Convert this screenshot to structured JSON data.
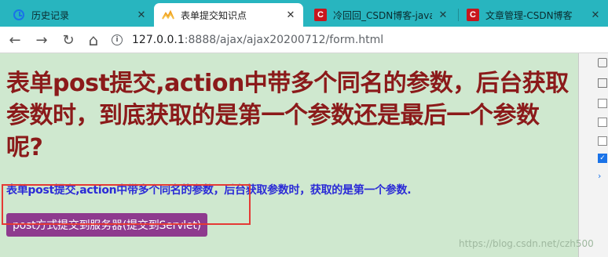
{
  "tabs": [
    {
      "label": "历史记录",
      "icon": "history-icon",
      "active": false
    },
    {
      "label": "表单提交知识点",
      "icon": "page-icon",
      "active": true
    },
    {
      "label": "冷回回_CSDN博客-java",
      "icon": "csdn-icon",
      "active": false
    },
    {
      "label": "文章管理-CSDN博客",
      "icon": "csdn-icon",
      "active": false
    }
  ],
  "nav": {
    "back": "←",
    "forward": "→",
    "reload": "↻",
    "home": "⌂"
  },
  "address": {
    "host": "127.0.0.1",
    "path": ":8888/ajax/ajax20200712/form.html"
  },
  "page": {
    "title": "表单post提交,action中带多个同名的参数，后台获取参数时，到底获取的是第一个参数还是最后一个参数呢?",
    "subtitle": "表单post提交,action中带多个同名的参数，后台获取参数时，获取的是第一个参数.",
    "submit_label": "post方式提交到服务器(提交到Servlet)"
  },
  "watermark": "https://blog.csdn.net/czh500",
  "colors": {
    "tabbar": "#28b5bf",
    "page_background": "#cfe8cf",
    "title": "#8b1a1a",
    "subtitle": "#2b2bd6",
    "button": "#8e3a8e",
    "highlight": "#e53935"
  }
}
